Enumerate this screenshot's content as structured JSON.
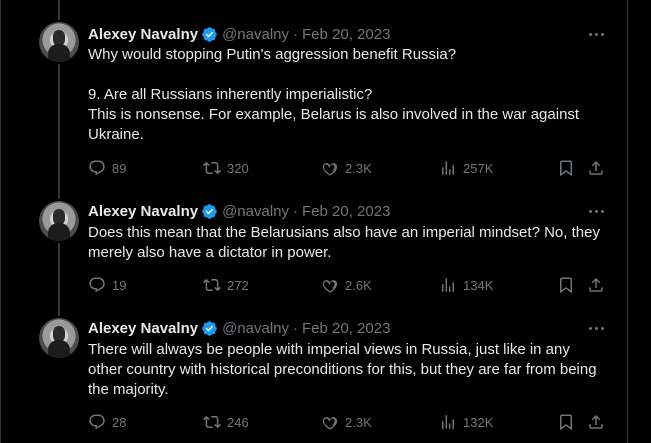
{
  "tweets": [
    {
      "author": "Alexey Navalny",
      "handle": "@navalny",
      "dot": "·",
      "date": "Feb 20, 2023",
      "text": "Why would stopping Putin's aggression benefit Russia?\n\n9. Are all Russians inherently imperialistic?\nThis is nonsense. For example, Belarus is also involved in the war against Ukraine.",
      "replies": "89",
      "retweets": "320",
      "likes": "2.3K",
      "views": "257K"
    },
    {
      "author": "Alexey Navalny",
      "handle": "@navalny",
      "dot": "·",
      "date": "Feb 20, 2023",
      "text": "Does this mean that the Belarusians also have an imperial mindset? No, they merely also have a dictator in power.",
      "replies": "19",
      "retweets": "272",
      "likes": "2.6K",
      "views": "134K"
    },
    {
      "author": "Alexey Navalny",
      "handle": "@navalny",
      "dot": "·",
      "date": "Feb 20, 2023",
      "text": "There will always be people with imperial views in Russia, just like in any other country with historical preconditions for this, but they are far from being the majority.",
      "replies": "28",
      "retweets": "246",
      "likes": "2.3K",
      "views": "132K"
    }
  ],
  "colors": {
    "background": "#000000",
    "text": "#e7e9ea",
    "muted": "#71767b",
    "verified": "#1d9bf0",
    "divider": "#2f3336"
  },
  "icons": [
    "verified-badge-icon",
    "more-icon",
    "reply-icon",
    "retweet-icon",
    "like-icon",
    "views-icon",
    "bookmark-icon",
    "share-icon"
  ]
}
